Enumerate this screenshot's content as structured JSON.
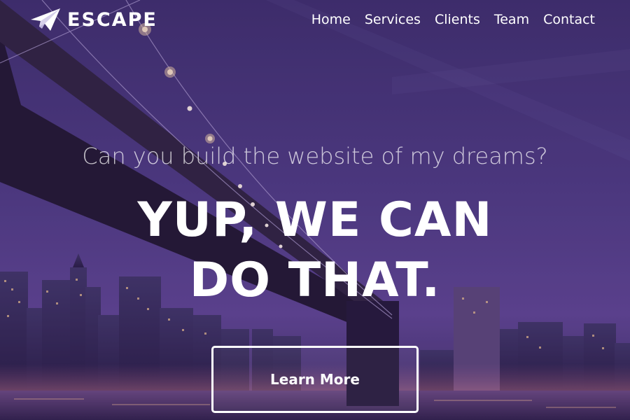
{
  "brand": {
    "name": "ESCAPE",
    "icon": "paper-plane-icon"
  },
  "nav": {
    "items": [
      {
        "label": "Home"
      },
      {
        "label": "Services"
      },
      {
        "label": "Clients"
      },
      {
        "label": "Team"
      },
      {
        "label": "Contact"
      }
    ]
  },
  "hero": {
    "subheading": "Can you build the website of my dreams?",
    "headline_line1": "YUP, WE CAN",
    "headline_line2": "DO THAT.",
    "cta_label": "Learn More",
    "background": "night-city-bridge-photo"
  },
  "colors": {
    "sky": "#3b2d6b",
    "overlay": "#5a3f8c",
    "text": "#ffffff"
  }
}
